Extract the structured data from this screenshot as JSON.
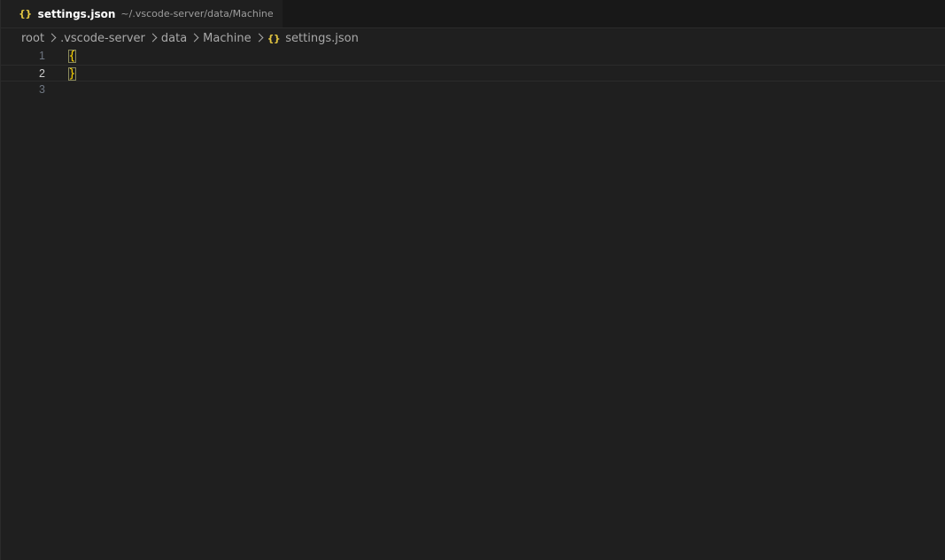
{
  "tab": {
    "icon": "{}",
    "title": "settings.json",
    "description": "~/.vscode-server/data/Machine"
  },
  "breadcrumbs": {
    "items": [
      "root",
      ".vscode-server",
      "data",
      "Machine"
    ],
    "file_icon": "{}",
    "file": "settings.json"
  },
  "editor": {
    "lines": [
      {
        "number": "1",
        "text": "{"
      },
      {
        "number": "2",
        "text": "}"
      },
      {
        "number": "3",
        "text": ""
      }
    ],
    "current_line": "2"
  },
  "colors": {
    "background": "#1f1f1f",
    "json_icon": "#e2c541",
    "bracket": "#ffd700"
  }
}
